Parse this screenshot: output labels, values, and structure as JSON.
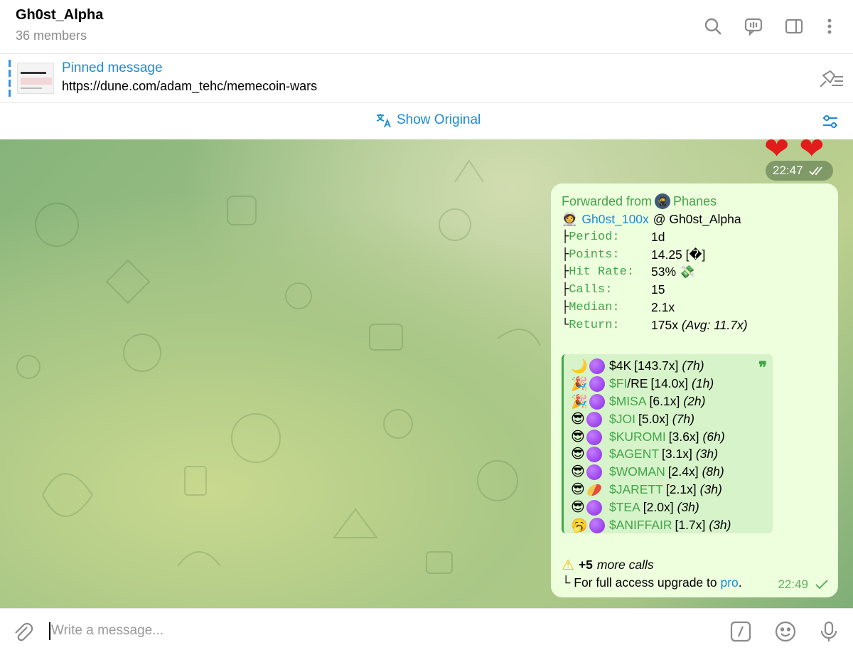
{
  "header": {
    "title": "Gh0st_Alpha",
    "subtitle": "36 members",
    "icons": [
      "search-icon",
      "video-chat-icon",
      "sidebar-toggle-icon",
      "more-vertical-icon"
    ]
  },
  "pinned": {
    "label": "Pinned message",
    "text": "https://dune.com/adam_tehc/memecoin-wars"
  },
  "translate": {
    "label": "Show Original"
  },
  "previous_message": {
    "reactions": [
      "❤",
      "❤"
    ],
    "time": "22:47"
  },
  "message": {
    "forwarded_label": "Forwarded from",
    "forwarded_name": "Phanes",
    "author_emoji": "🧑‍🚀",
    "author_name": "Gh0st_100x",
    "author_at": "@ Gh0st_Alpha",
    "stats": [
      {
        "tree": "├",
        "key": "Period:",
        "value": "1d",
        "extra": ""
      },
      {
        "tree": "├",
        "key": "Points:",
        "value": "14.25 [�]",
        "extra": ""
      },
      {
        "tree": "├",
        "key": "Hit Rate:",
        "value": "53% ",
        "extra": "💸"
      },
      {
        "tree": "├",
        "key": "Calls:",
        "value": "15",
        "extra": ""
      },
      {
        "tree": "├",
        "key": "Median:",
        "value": "2.1x",
        "extra": ""
      },
      {
        "tree": "└",
        "key": "Return:",
        "value": "175x ",
        "extra": "(Avg: 11.7x)"
      }
    ],
    "calls": [
      {
        "emoji": "🌙",
        "marker": "dot",
        "symbol": "$4K",
        "symbol_color": "black",
        "mult": "[143.7x]",
        "age": "(7h)"
      },
      {
        "emoji": "🎉",
        "marker": "dot",
        "symbol": "$FI",
        "symbol_color": "green",
        "suffix": "/RE",
        "mult": "[14.0x]",
        "age": "(1h)"
      },
      {
        "emoji": "🎉",
        "marker": "dot",
        "symbol": "$MISA",
        "symbol_color": "green",
        "mult": "[6.1x]",
        "age": "(2h)"
      },
      {
        "emoji": "😎",
        "marker": "dot",
        "symbol": "$JOI",
        "symbol_color": "green",
        "mult": "[5.0x]",
        "age": "(7h)"
      },
      {
        "emoji": "😎",
        "marker": "dot",
        "symbol": "$KUROMI",
        "symbol_color": "green",
        "mult": "[3.6x]",
        "age": "(6h)"
      },
      {
        "emoji": "😎",
        "marker": "dot",
        "symbol": "$AGENT",
        "symbol_color": "green",
        "mult": "[3.1x]",
        "age": "(3h)"
      },
      {
        "emoji": "😎",
        "marker": "dot",
        "symbol": "$WOMAN",
        "symbol_color": "green",
        "mult": "[2.4x]",
        "age": "(8h)"
      },
      {
        "emoji": "😎",
        "marker": "pill",
        "symbol": "$JARETT",
        "symbol_color": "green",
        "mult": "[2.1x]",
        "age": "(3h)"
      },
      {
        "emoji": "😎",
        "marker": "dot",
        "symbol": "$TEA",
        "symbol_color": "green",
        "mult": "[2.0x]",
        "age": "(3h)"
      },
      {
        "emoji": "🥱",
        "marker": "dot",
        "symbol": "$ANIFFAIR",
        "symbol_color": "green",
        "mult": "[1.7x]",
        "age": "(3h)"
      }
    ],
    "more_count": "+5",
    "more_text": "more calls",
    "upgrade_prefix": "└ For full access upgrade to ",
    "upgrade_link": "pro",
    "upgrade_suffix": ".",
    "time": "22:49"
  },
  "composer": {
    "placeholder": "Write a message..."
  },
  "colors": {
    "accent": "#1a8ad5",
    "green": "#41a548",
    "bubble": "#eeffde"
  }
}
